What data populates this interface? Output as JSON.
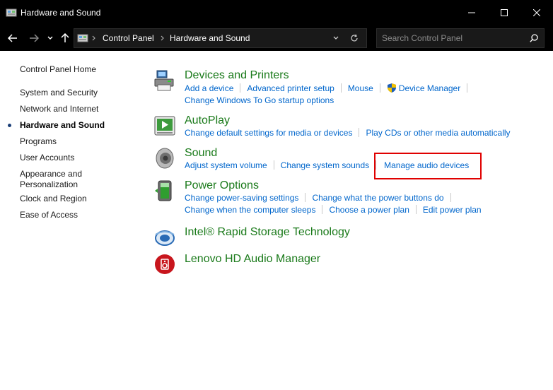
{
  "window": {
    "title": "Hardware and Sound"
  },
  "address": {
    "crumbs": [
      "Control Panel",
      "Hardware and Sound"
    ]
  },
  "search": {
    "placeholder": "Search Control Panel"
  },
  "leftnav": {
    "home": "Control Panel Home",
    "items": [
      "System and Security",
      "Network and Internet",
      "Hardware and Sound",
      "Programs",
      "User Accounts",
      "Appearance and Personalization",
      "Clock and Region",
      "Ease of Access"
    ],
    "current": "Hardware and Sound"
  },
  "categories": {
    "devices": {
      "title": "Devices and Printers",
      "links": [
        "Add a device",
        "Advanced printer setup",
        "Mouse",
        "Device Manager",
        "Change Windows To Go startup options"
      ]
    },
    "autoplay": {
      "title": "AutoPlay",
      "links": [
        "Change default settings for media or devices",
        "Play CDs or other media automatically"
      ]
    },
    "sound": {
      "title": "Sound",
      "links": [
        "Adjust system volume",
        "Change system sounds",
        "Manage audio devices"
      ]
    },
    "power": {
      "title": "Power Options",
      "links": [
        "Change power-saving settings",
        "Change what the power buttons do",
        "Change when the computer sleeps",
        "Choose a power plan",
        "Edit power plan"
      ]
    },
    "intel": {
      "title": "Intel® Rapid Storage Technology"
    },
    "lenovo": {
      "title": "Lenovo HD Audio Manager"
    }
  },
  "colors": {
    "category_title": "#1a7a1a",
    "link": "#0066cc",
    "highlight": "#e00000"
  }
}
